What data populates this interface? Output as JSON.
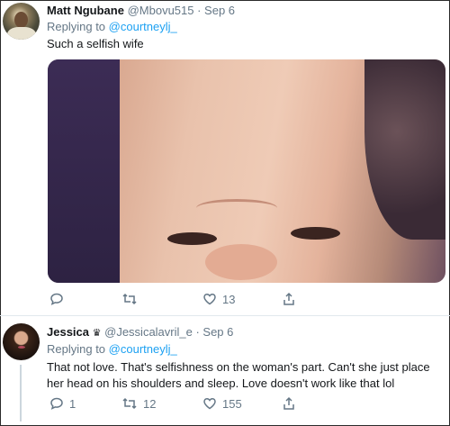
{
  "tweets": [
    {
      "display_name": "Matt Ngubane",
      "handle_date": "@Mbovu515 · Sep 6",
      "replying_prefix": "Replying to",
      "replying_to": "@courtneylj_",
      "text": "Such a selfish wife",
      "media": "baby-grimace-photo",
      "actions": {
        "reply": "",
        "retweet": "",
        "like": "13",
        "share": ""
      }
    },
    {
      "display_name": "Jessica",
      "badge_icon": "crown-icon",
      "handle_date": "@Jessicalavril_e · Sep 6",
      "replying_prefix": "Replying to",
      "replying_to": "@courtneylj_",
      "text": "That not love. That's selfishness on the woman's part. Can't she just place her head on his shoulders and sleep. Love doesn't work like that lol",
      "actions": {
        "reply": "1",
        "retweet": "12",
        "like": "155",
        "share": ""
      }
    }
  ],
  "colors": {
    "link": "#1da1f2",
    "secondary": "#657786",
    "text": "#14171a"
  }
}
